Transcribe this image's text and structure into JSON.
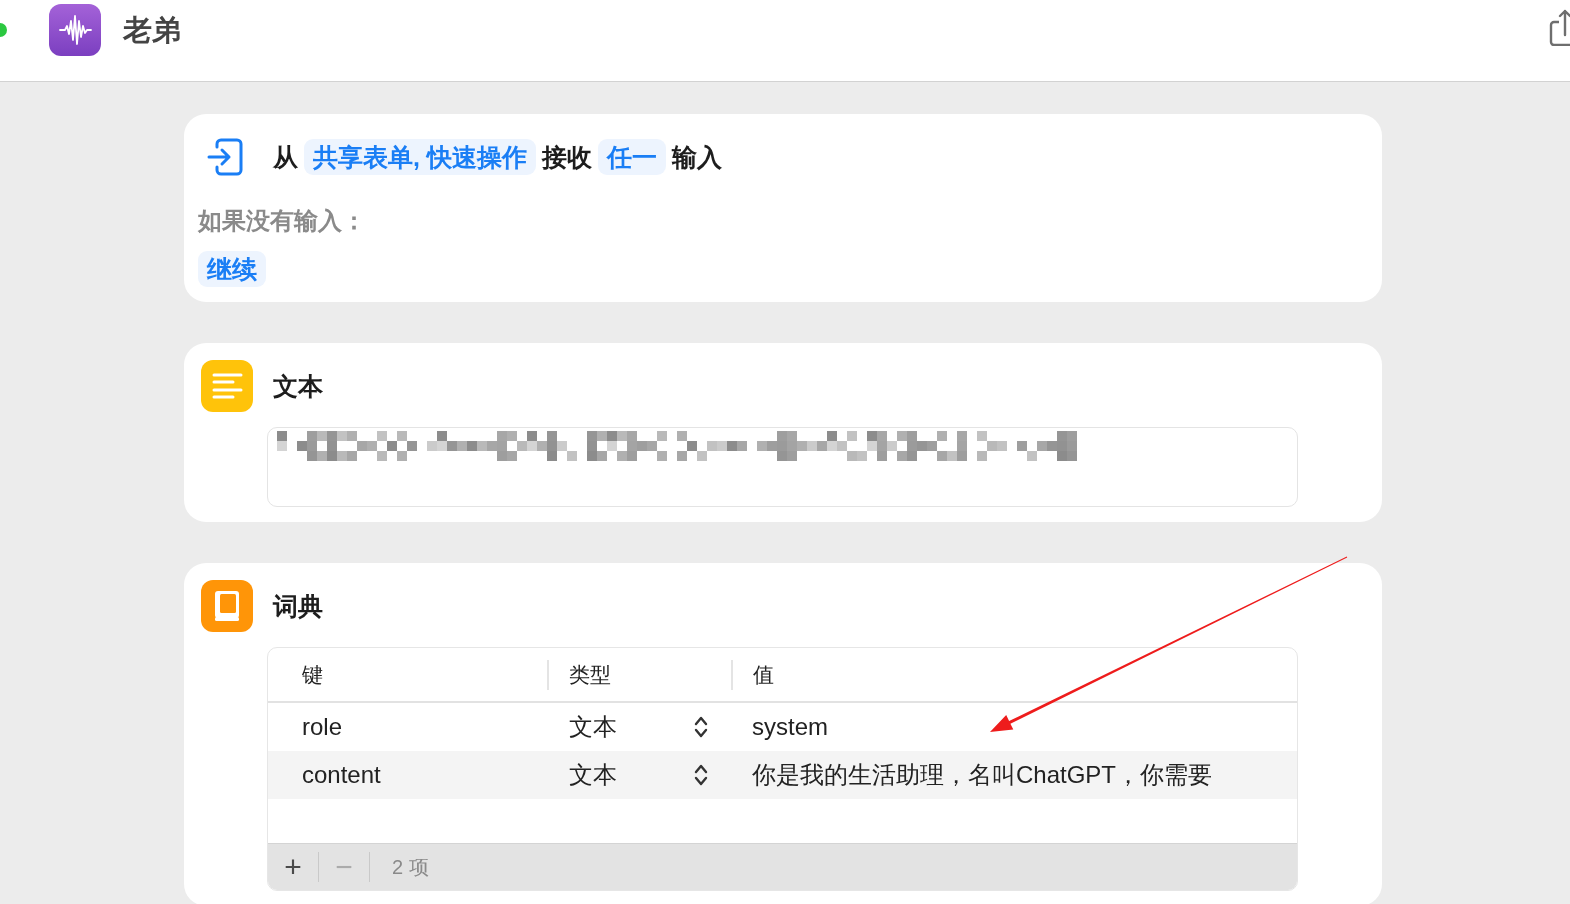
{
  "window": {
    "title": "老弟"
  },
  "actions": [
    {
      "kind": "receive_input",
      "sentence": [
        {
          "kind": "word",
          "text": "从"
        },
        {
          "kind": "token",
          "text": "共享表单, 快速操作"
        },
        {
          "kind": "word",
          "text": "接收"
        },
        {
          "kind": "token",
          "text": "任一"
        },
        {
          "kind": "word",
          "text": "输入"
        }
      ],
      "fallback": {
        "label": "如果没有输入：",
        "value": "继续"
      }
    },
    {
      "kind": "text",
      "title": "文本",
      "field": {
        "redacted": true
      }
    },
    {
      "kind": "dictionary",
      "title": "词典",
      "columns": [
        "键",
        "类型",
        "值"
      ],
      "rows": [
        {
          "key": "role",
          "type": "文本",
          "value": "system"
        },
        {
          "key": "content",
          "type": "文本",
          "value": "你是我的生活助理，名叫ChatGPT，你需要"
        }
      ],
      "footer": {
        "buttons": [
          {
            "label": "+",
            "disabled": false
          },
          {
            "label": "−",
            "disabled": true
          }
        ],
        "count": "2 项"
      }
    }
  ]
}
